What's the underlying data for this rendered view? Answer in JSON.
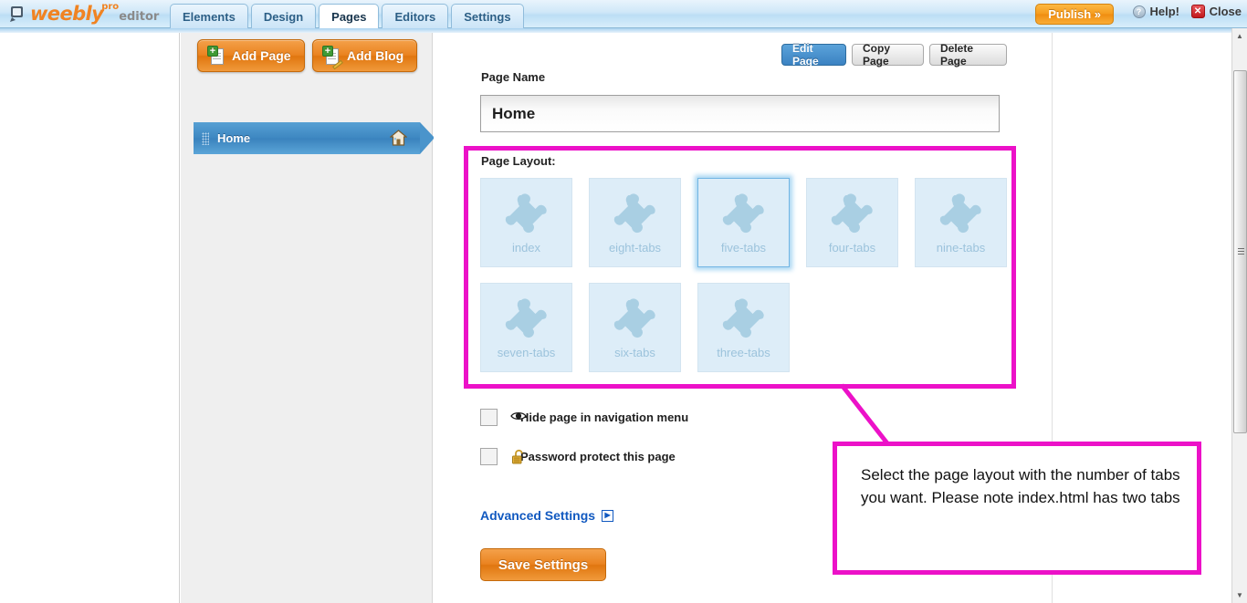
{
  "app": {
    "brand_word": "weebly",
    "brand_sup": "pro",
    "brand_sub": "editor",
    "accent_orange": "#ef8d10",
    "accent_blue": "#3b82c2",
    "annotation_magenta": "#ec11c8"
  },
  "topbar": {
    "tabs": [
      {
        "label": "Elements",
        "active": false
      },
      {
        "label": "Design",
        "active": false
      },
      {
        "label": "Pages",
        "active": true
      },
      {
        "label": "Editors",
        "active": false
      },
      {
        "label": "Settings",
        "active": false
      }
    ],
    "publish_label": "Publish »",
    "help_label": "Help!",
    "help_icon": "question-circle-icon",
    "close_label": "Close",
    "close_icon": "close-circle-icon"
  },
  "pages_panel": {
    "add_page_label": "Add Page",
    "add_page_icon": "new-document-icon",
    "add_blog_label": "Add Blog",
    "add_blog_icon": "new-blog-icon",
    "items": [
      {
        "label": "Home",
        "icon": "home-icon",
        "grip": "drag-grip-icon",
        "selected": true
      }
    ]
  },
  "main": {
    "actions": [
      {
        "label": "Edit Page",
        "primary": true
      },
      {
        "label": "Copy Page",
        "primary": false
      },
      {
        "label": "Delete Page",
        "primary": false
      }
    ],
    "page_name_label": "Page Name",
    "page_name_value": "Home",
    "page_name_placeholder": "Page Name",
    "layout_label": "Page Layout:",
    "layouts_row1": [
      {
        "label": "index",
        "selected": false
      },
      {
        "label": "eight-tabs",
        "selected": false
      },
      {
        "label": "five-tabs",
        "selected": true
      },
      {
        "label": "four-tabs",
        "selected": false
      },
      {
        "label": "nine-tabs",
        "selected": false
      }
    ],
    "layouts_row2": [
      {
        "label": "seven-tabs",
        "selected": false
      },
      {
        "label": "six-tabs",
        "selected": false
      },
      {
        "label": "three-tabs",
        "selected": false
      }
    ],
    "checkboxes": [
      {
        "label": "Hide page in navigation menu",
        "icon": "eye-icon",
        "checked": false
      },
      {
        "label": "Password protect this page",
        "icon": "unlocked-padlock-icon",
        "checked": false
      }
    ],
    "advanced_label": "Advanced Settings",
    "advanced_icon": "play-arrow-box-icon",
    "save_label": "Save Settings"
  },
  "annotation": {
    "callout_text": "Select the page layout with the number of tabs you want. Please note index.html has two tabs"
  },
  "scrollbar": {
    "up_glyph": "▲",
    "down_glyph": "▼"
  }
}
